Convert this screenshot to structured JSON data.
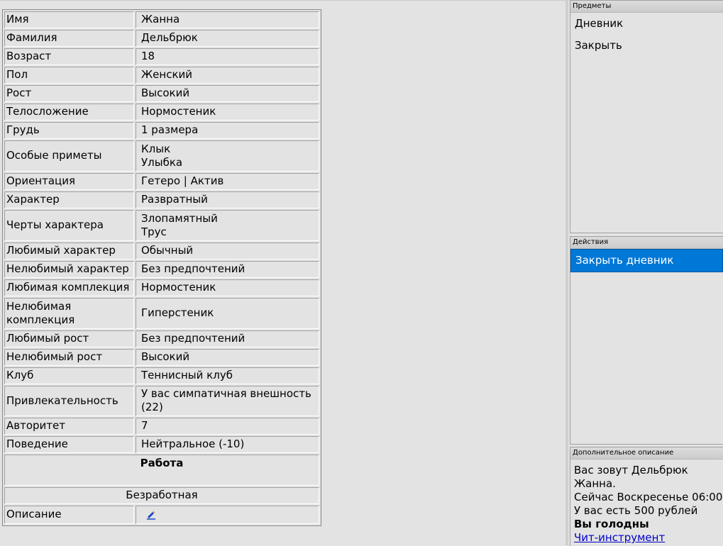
{
  "profile": {
    "rows": [
      {
        "label": "Имя",
        "value": [
          "Жанна"
        ]
      },
      {
        "label": "Фамилия",
        "value": [
          "Дельбрюк"
        ]
      },
      {
        "label": "Возраст",
        "value": [
          "18"
        ]
      },
      {
        "label": "Пол",
        "value": [
          "Женский"
        ]
      },
      {
        "label": "Рост",
        "value": [
          "Высокий"
        ]
      },
      {
        "label": "Телосложение",
        "value": [
          "Нормостеник"
        ]
      },
      {
        "label": "Грудь",
        "value": [
          "1 размера"
        ]
      },
      {
        "label": "Особые приметы",
        "value": [
          "Клык",
          "Улыбка"
        ]
      },
      {
        "label": "Ориентация",
        "value": [
          "Гетеро | Актив"
        ]
      },
      {
        "label": "Характер",
        "value": [
          "Развратный"
        ]
      },
      {
        "label": "Черты характера",
        "value": [
          "Злопамятный",
          "Трус"
        ]
      },
      {
        "label": "Любимый характер",
        "value": [
          "Обычный"
        ]
      },
      {
        "label": "Нелюбимый характер",
        "value": [
          "Без предпочтений"
        ]
      },
      {
        "label": "Любимая комплекция",
        "value": [
          "Нормостеник"
        ]
      },
      {
        "label": "Нелюбимая комплекция",
        "value": [
          "Гиперстеник"
        ]
      },
      {
        "label": "Любимый рост",
        "value": [
          "Без предпочтений"
        ]
      },
      {
        "label": "Нелюбимый рост",
        "value": [
          "Высокий"
        ]
      },
      {
        "label": "Клуб",
        "value": [
          "Теннисный клуб"
        ]
      },
      {
        "label": "Привлекательность",
        "value": [
          "У вас симпатичная внешность (22)"
        ]
      },
      {
        "label": "Авторитет",
        "value": [
          "7"
        ]
      },
      {
        "label": "Поведение",
        "value": [
          "Нейтральное (-10)"
        ]
      }
    ],
    "work_title": "Работа",
    "work_value": "Безработная",
    "description_label": "Описание",
    "edit_icon": "pencil-icon"
  },
  "side": {
    "items_panel": {
      "title": "Предметы",
      "items": [
        "Дневник",
        "Закрыть"
      ]
    },
    "actions_panel": {
      "title": "Действия",
      "items": [
        "Закрыть дневник"
      ],
      "selected_index": 0
    },
    "extra_panel": {
      "title": "Дополнительное описание",
      "line1": "Вас зовут Дельбрюк Жанна.",
      "line2": "Сейчас Воскресенье 06:00",
      "line3": "У вас есть 500 рублей",
      "line4": "Вы голодны",
      "link": "Чит-инструмент"
    }
  },
  "colors": {
    "selection": "#0078d7",
    "link": "#0000cc",
    "background": "#e3e3e3"
  }
}
